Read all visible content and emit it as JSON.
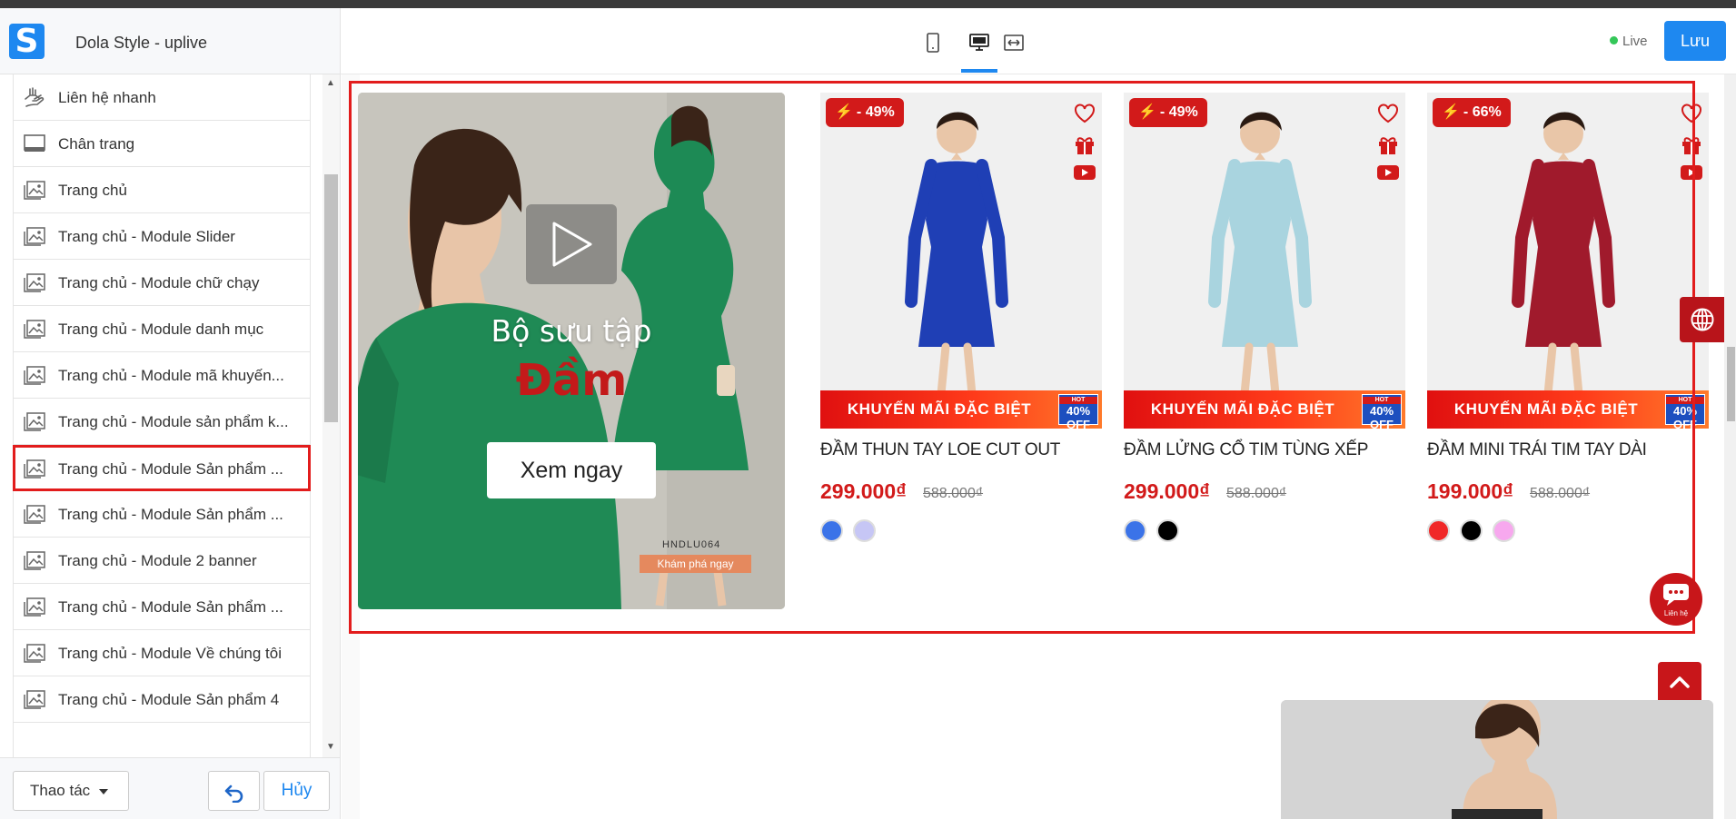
{
  "app": {
    "title": "Dola Style - uplive",
    "logo_letter": "S"
  },
  "topbar": {
    "device_icons": [
      "mobile-icon",
      "desktop-icon",
      "fullwidth-icon"
    ],
    "active_device": "desktop",
    "live_label": "Live",
    "save_label": "Lưu"
  },
  "sidebar": {
    "items": [
      {
        "label": "Liên hệ nhanh",
        "icon": "contact-hand-icon"
      },
      {
        "label": "Chân trang",
        "icon": "footer-layout-icon"
      },
      {
        "label": "Trang chủ",
        "icon": "image-icon"
      },
      {
        "label": "Trang chủ - Module Slider",
        "icon": "image-icon"
      },
      {
        "label": "Trang chủ - Module chữ chạy",
        "icon": "image-icon"
      },
      {
        "label": "Trang chủ - Module danh mục",
        "icon": "image-icon"
      },
      {
        "label": "Trang chủ - Module mã khuyến...",
        "icon": "image-icon"
      },
      {
        "label": "Trang chủ - Module sản phẩm k...",
        "icon": "image-icon"
      },
      {
        "label": "Trang chủ - Module Sản phẩm ...",
        "icon": "image-icon",
        "selected": true
      },
      {
        "label": "Trang chủ - Module Sản phẩm ...",
        "icon": "image-icon"
      },
      {
        "label": "Trang chủ - Module 2 banner",
        "icon": "image-icon"
      },
      {
        "label": "Trang chủ - Module Sản phẩm ...",
        "icon": "image-icon"
      },
      {
        "label": "Trang chủ - Module Về chúng tôi",
        "icon": "image-icon"
      },
      {
        "label": "Trang chủ - Module Sản phẩm 4",
        "icon": "image-icon"
      }
    ],
    "footer": {
      "actions_label": "Thao tác",
      "cancel_label": "Hủy"
    }
  },
  "preview": {
    "banner": {
      "subtitle": "Bộ sưu tập",
      "title": "Đầm",
      "button": "Xem ngay",
      "code": "HNDLU064",
      "cta": "Khám phá ngay"
    },
    "strip_label": "KHUYẾN MÃI ĐẶC BIỆT",
    "strip_off": "40% OFF",
    "strip_hot": "HOT",
    "products": [
      {
        "badge": "- 49%",
        "name": "ĐẦM THUN TAY LOE CUT OUT",
        "price": "299.000₫",
        "old_price": "588.000₫",
        "dress_color": "#1f3fb5",
        "swatches": [
          "#3b73e8",
          "#c6c6f5"
        ]
      },
      {
        "badge": "- 49%",
        "name": "ĐẦM LỬNG CỔ TIM TÙNG XẾP",
        "price": "299.000₫",
        "old_price": "588.000₫",
        "dress_color": "#a9d4df",
        "swatches": [
          "#3b73e8",
          "#000000"
        ]
      },
      {
        "badge": "- 66%",
        "name": "ĐẦM MINI TRÁI TIM TAY DÀI",
        "price": "199.000₫",
        "old_price": "588.000₫",
        "dress_color": "#a01a2c",
        "swatches": [
          "#f02828",
          "#000000",
          "#f7a8ee"
        ]
      }
    ],
    "contact_label": "Liên hệ"
  },
  "colors": {
    "accent": "#1e88f0",
    "selection": "#e21c1c",
    "sale": "#d21a1a"
  }
}
